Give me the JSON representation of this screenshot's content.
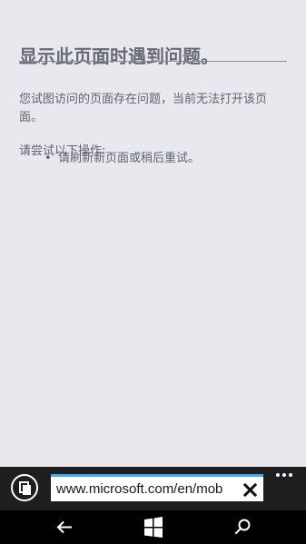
{
  "error_page": {
    "title": "显示此页面时遇到问题。",
    "message": "您试图访问的页面存在问题，当前无法打开该页面。",
    "suggestion_heading": "请尝试以下操作:",
    "suggestions": [
      {
        "bullet": "•",
        "text": "请刷新新页面或稍后重试。"
      }
    ]
  },
  "browser_bar": {
    "tabs_icon": "tabs-icon",
    "address": "www.microsoft.com/en/mob",
    "clear_icon": "close-icon",
    "more_icon": "ellipsis-icon",
    "accent_color": "#3ca7ff"
  },
  "system_nav": {
    "back_icon": "back-arrow-icon",
    "home_icon": "windows-icon",
    "search_icon": "search-icon"
  }
}
